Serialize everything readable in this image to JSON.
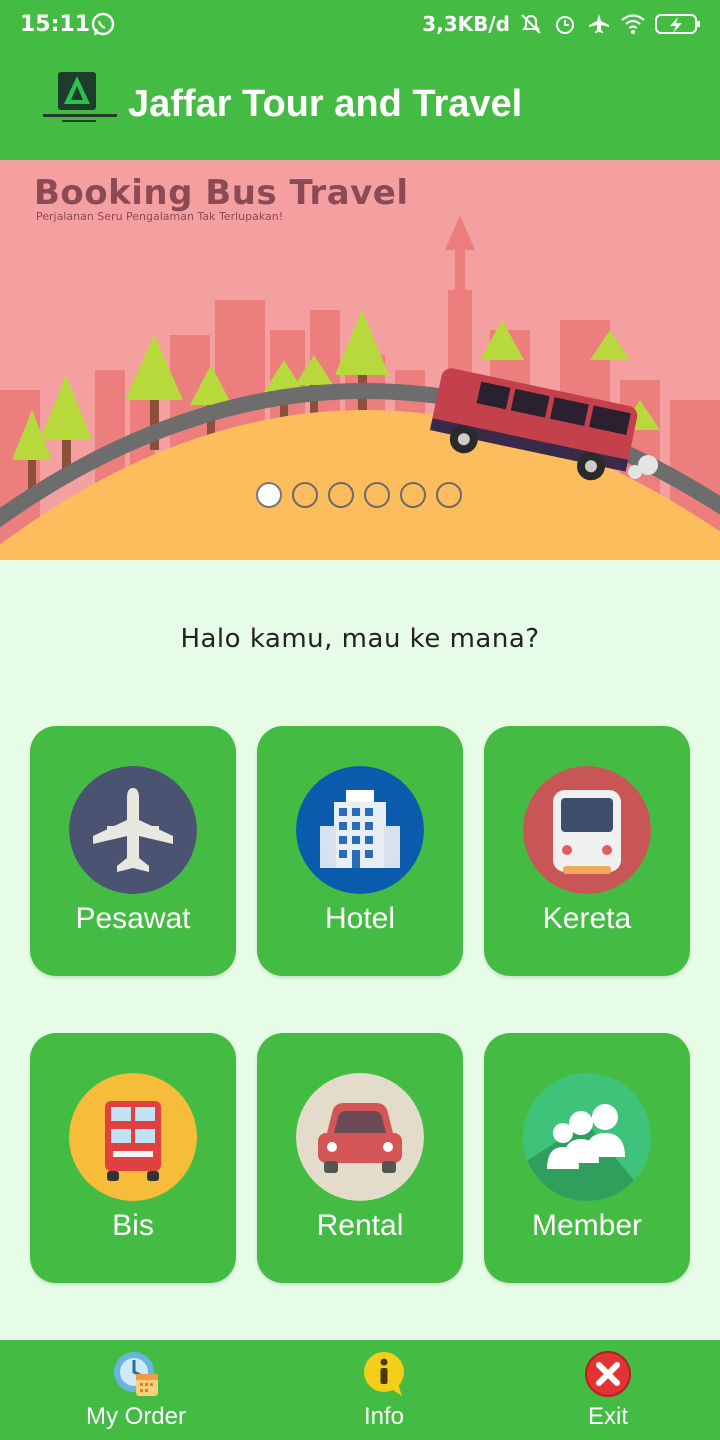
{
  "status_bar": {
    "time": "15:11",
    "network_speed": "3,3KB/d",
    "icons": [
      "whatsapp-icon",
      "mute-icon",
      "alarm-icon",
      "airplane-icon",
      "wifi-icon",
      "battery-charging-icon"
    ]
  },
  "app_bar": {
    "title": "Jaffar Tour and Travel",
    "logo_icon": "jaffar-logo-icon"
  },
  "banner": {
    "title": "Booking Bus Travel",
    "subtitle": "Perjalanan Seru Pengalaman Tak Terlupakan!",
    "slides": 6,
    "active_slide": 1
  },
  "greeting": "Halo kamu, mau ke mana?",
  "menu": [
    {
      "label": "Pesawat",
      "icon": "airplane-icon",
      "color": "#4a5472"
    },
    {
      "label": "Hotel",
      "icon": "hotel-icon",
      "color": "#0b5bad"
    },
    {
      "label": "Kereta",
      "icon": "train-icon",
      "color": "#c95656"
    },
    {
      "label": "Bis",
      "icon": "bus-icon",
      "color": "#f7bd3a"
    },
    {
      "label": "Rental",
      "icon": "car-icon",
      "color": "#e3dccb"
    },
    {
      "label": "Member",
      "icon": "group-icon",
      "color": "#3fc37a"
    }
  ],
  "bottom_nav": [
    {
      "label": "My Order",
      "icon": "order-calendar-icon"
    },
    {
      "label": "Info",
      "icon": "info-icon"
    },
    {
      "label": "Exit",
      "icon": "exit-icon"
    }
  ],
  "colors": {
    "primary": "#44bc44",
    "background": "#e6fce6",
    "banner_pink": "#f5a0a0",
    "banner_ground": "#fdbd5c"
  }
}
